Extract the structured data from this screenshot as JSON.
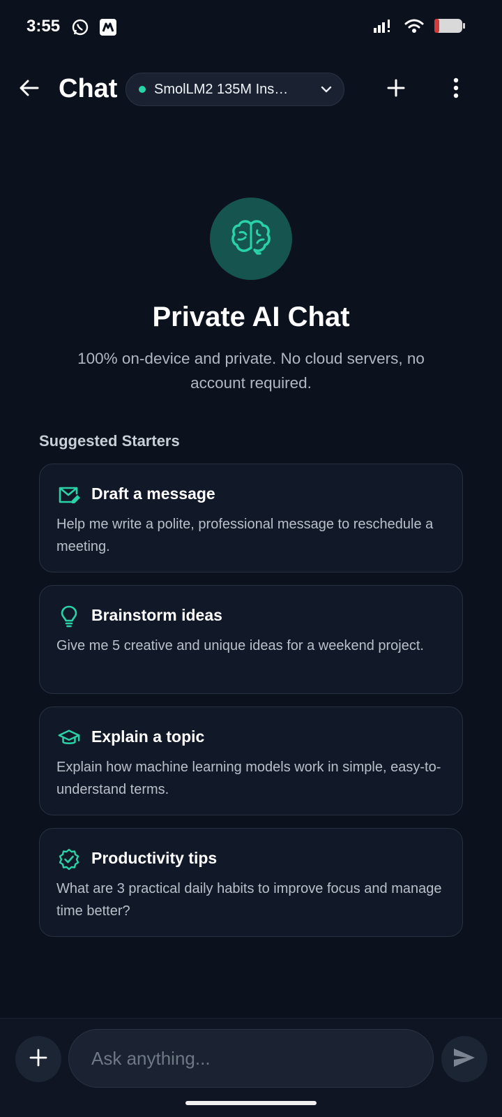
{
  "status_bar": {
    "time": "3:55",
    "left_icons": [
      "whatsapp-icon",
      "app-notification-icon"
    ],
    "right_icons": [
      "signal-icon",
      "wifi-icon",
      "battery-icon"
    ]
  },
  "header": {
    "title": "Chat",
    "model_name": "SmolLM2 135M Ins…",
    "model_status_color": "#2ad3a7",
    "icons": [
      "back-arrow-icon",
      "chevron-down-icon",
      "plus-icon",
      "more-vertical-icon"
    ]
  },
  "hero": {
    "icon": "brain-icon",
    "title": "Private AI Chat",
    "subtitle": "100% on-device and private. No cloud servers, no account required."
  },
  "suggestions": {
    "label": "Suggested Starters",
    "items": [
      {
        "icon": "mail-edit-icon",
        "title": "Draft a message",
        "description": "Help me write a polite, professional message to reschedule a meeting."
      },
      {
        "icon": "lightbulb-icon",
        "title": "Brainstorm ideas",
        "description": "Give me 5 creative and unique ideas for a weekend project."
      },
      {
        "icon": "graduation-cap-icon",
        "title": "Explain a topic",
        "description": "Explain how machine learning models work in simple, easy-to-understand terms."
      },
      {
        "icon": "badge-check-icon",
        "title": "Productivity tips",
        "description": "What are 3 practical daily habits to improve focus and manage time better?"
      }
    ]
  },
  "composer": {
    "placeholder": "Ask anything...",
    "value": "",
    "icons": [
      "plus-icon",
      "send-icon"
    ]
  },
  "colors": {
    "background": "#0b111d",
    "accent": "#2ad3a7",
    "card_background": "#111827",
    "hero_circle": "#16544f"
  }
}
